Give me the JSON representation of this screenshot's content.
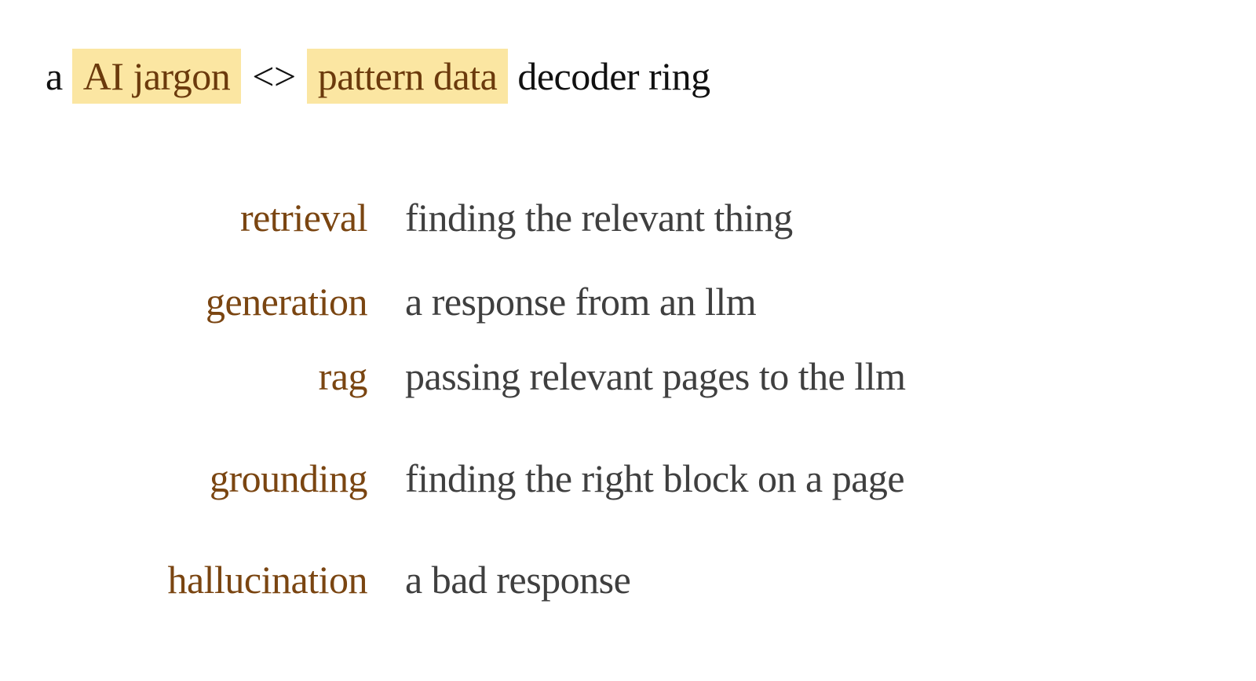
{
  "title": {
    "prefix": "a",
    "highlight_1": "AI jargon",
    "separator": "<>",
    "highlight_2": "pattern data",
    "suffix": "decoder ring"
  },
  "colors": {
    "highlight_bg": "#fbe6a2",
    "term_text": "#7a4511",
    "definition_text": "#3f3f3f",
    "title_text": "#111111"
  },
  "definitions": [
    {
      "term": "retrieval",
      "meaning": "finding the relevant thing"
    },
    {
      "term": "generation",
      "meaning": "a response from an llm"
    },
    {
      "term": "rag",
      "meaning": "passing relevant pages to the llm"
    },
    {
      "term": "grounding",
      "meaning": "finding the right block on a page"
    },
    {
      "term": "hallucination",
      "meaning": "a bad response"
    }
  ]
}
